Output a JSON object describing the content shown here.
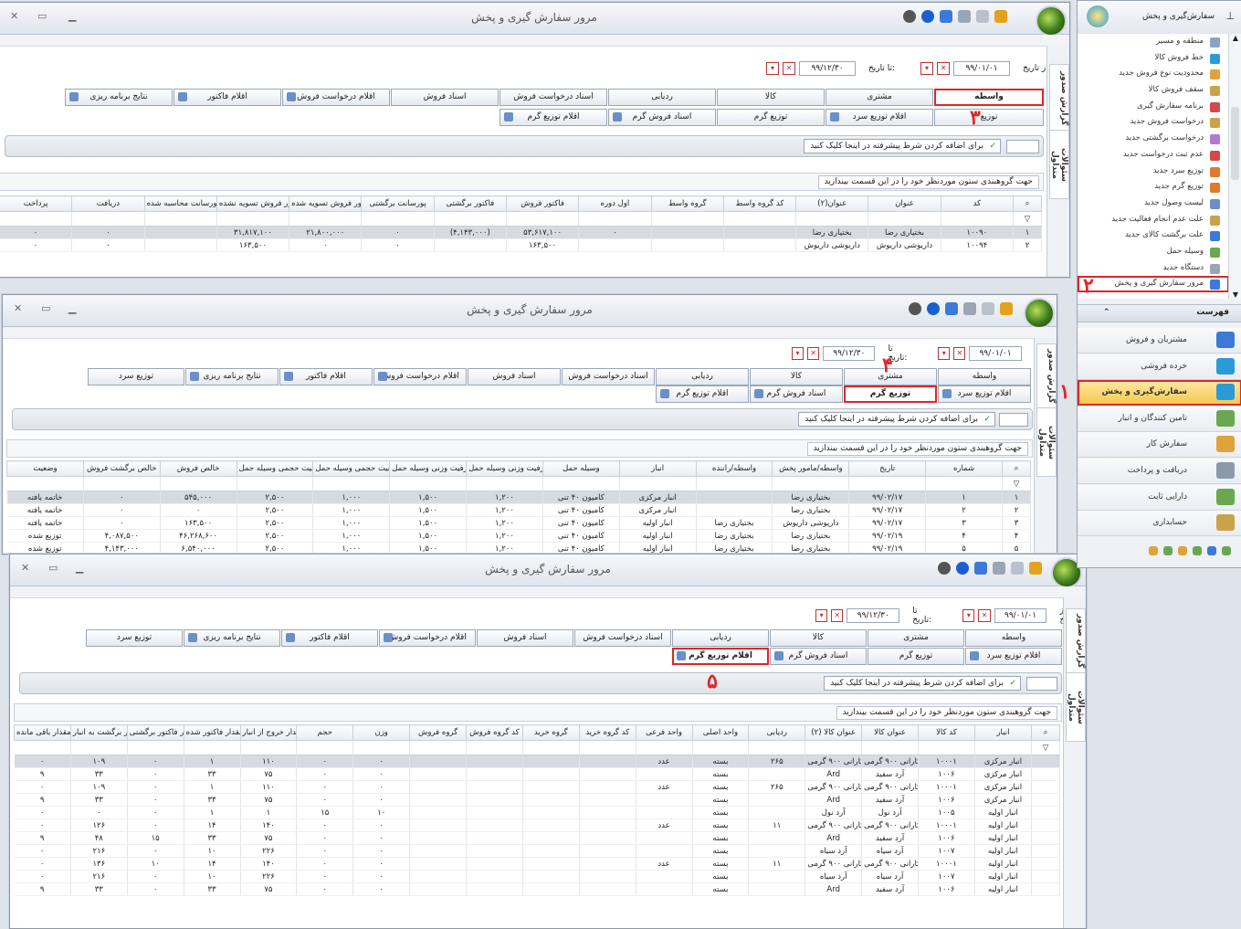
{
  "common": {
    "window_title": "مرور سفارش گیری و پخش",
    "from_label": "از تاریخ:",
    "to_label": "تا تاریخ:",
    "from_date": "۹۹/۰۱/۰۱",
    "to_date": "۹۹/۱۲/۳۰",
    "vtab_report": "گزارش صدور",
    "vtab_questions": "سئوالات متداول",
    "advanced_filter": "برای اضافه کردن شرط پیشرفته در اینجا کلیک کنید",
    "group_hint": "جهت گروهبندی ستون موردنظر خود را در این قسمت بیندازید"
  },
  "win1": {
    "tabs_row1": [
      "واسطه",
      "مشتری",
      "کالا",
      "ردیابی",
      "اسناد درخواست فروش",
      "اسناد فروش",
      "اقلام درخواست فروش",
      "اقلام فاکتور",
      "نتایج برنامه ریزی"
    ],
    "tabs_row2": [
      "توزیع",
      "اقلام توزیع سرد",
      "توزیع گرم",
      "اسناد فروش گرم",
      "اقلام توزیع گرم"
    ],
    "columns": [
      "کد",
      "عنوان",
      "عنوان(۲)",
      "کد گروه واسط",
      "گروه واسط",
      "اول دوره",
      "فاکتور فروش",
      "فاکتور برگشتی",
      "پورسانت برگشتی",
      "فاکتور فروش تسویه شده",
      "فاکتور فروش تسویه نشده",
      "مبلغ پورسانت محاسبه شده",
      "دریافت",
      "پرداخت"
    ],
    "rows": [
      [
        "۱۰۰۹۰",
        "بختیاری رضا",
        "بختیاری رضا",
        "",
        "",
        "۰",
        "۵۳,۶۱۷,۱۰۰",
        "(۴,۱۴۳,۰۰۰)",
        "۰",
        "۲۱,۸۰۰,۰۰۰",
        "۳۱,۸۱۷,۱۰۰",
        "",
        "۰",
        "۰"
      ],
      [
        "۱۰۰۹۴",
        "داریوشی داریوش",
        "داریوشی داریوش",
        "",
        "",
        "",
        "۱۶۳,۵۰۰",
        "",
        "۰",
        "۰",
        "۱۶۳,۵۰۰",
        "",
        "۰",
        "۰"
      ]
    ],
    "row_index": [
      "۱",
      "۲"
    ]
  },
  "win2": {
    "tabs_row1": [
      "واسطه",
      "مشتری",
      "کالا",
      "ردیابی",
      "اسناد درخواست فروش",
      "اسناد فروش",
      "اقلام درخواست فروش",
      "اقلام فاکتور",
      "نتایج برنامه ریزی",
      "توزیع سرد"
    ],
    "tabs_row2": [
      "اقلام توزیع سرد",
      "توزیع گرم",
      "اسناد فروش گرم",
      "اقلام توزیع گرم"
    ],
    "columns": [
      "شماره",
      "تاریخ",
      "واسطه/مامور پخش",
      "واسطه/راننده",
      "انبار",
      "وسیله حمل",
      "حداقل ظرفیت وزنی وسیله حمل",
      "حداکثر ظرفیت وزنی وسیله حمل",
      "حداقل ظرفیت حجمی وسیله حمل",
      "حداکثر ظرفیت حجمی وسیله حمل",
      "خالص فروش",
      "خالص برگشت فروش",
      "وضعیت"
    ],
    "rows": [
      [
        "۱",
        "۹۹/۰۲/۱۷",
        "بختیاری رضا",
        "",
        "انبار مرکزی",
        "کامیون ۴۰ تنی",
        "۱,۲۰۰",
        "۱,۵۰۰",
        "۱,۰۰۰",
        "۲,۵۰۰",
        "۵۴۵,۰۰۰",
        "۰",
        "خاتمه یافته"
      ],
      [
        "۲",
        "۹۹/۰۲/۱۷",
        "بختیاری رضا",
        "",
        "انبار مرکزی",
        "کامیون ۴۰ تنی",
        "۱,۲۰۰",
        "۱,۵۰۰",
        "۱,۰۰۰",
        "۲,۵۰۰",
        "۰",
        "۰",
        "خاتمه یافته"
      ],
      [
        "۳",
        "۹۹/۰۲/۱۷",
        "داریوشی داریوش",
        "بختیاری رضا",
        "انبار اولیه",
        "کامیون ۴۰ تنی",
        "۱,۲۰۰",
        "۱,۵۰۰",
        "۱,۰۰۰",
        "۲,۵۰۰",
        "۱۶۳,۵۰۰",
        "۰",
        "خاتمه یافته"
      ],
      [
        "۴",
        "۹۹/۰۲/۱۹",
        "بختیاری رضا",
        "بختیاری رضا",
        "انبار اولیه",
        "کامیون ۴۰ تنی",
        "۱,۲۰۰",
        "۱,۵۰۰",
        "۱,۰۰۰",
        "۲,۵۰۰",
        "۴۶,۲۶۸,۶۰۰",
        "۴,۰۸۷,۵۰۰",
        "توزیع شده"
      ],
      [
        "۵",
        "۹۹/۰۲/۱۹",
        "بختیاری رضا",
        "بختیاری رضا",
        "انبار اولیه",
        "کامیون ۴۰ تنی",
        "۱,۲۰۰",
        "۱,۵۰۰",
        "۱,۰۰۰",
        "۲,۵۰۰",
        "۶,۵۴۰,۰۰۰",
        "۴,۱۴۳,۰۰۰",
        "توزیع شده"
      ]
    ],
    "row_index": [
      "۱",
      "۲",
      "۳",
      "۴",
      "۵"
    ]
  },
  "win3": {
    "tabs_row1": [
      "واسطه",
      "مشتری",
      "کالا",
      "ردیابی",
      "اسناد درخواست فروش",
      "اسناد فروش",
      "اقلام درخواست فروش",
      "اقلام فاکتور",
      "نتایج برنامه ریزی",
      "توزیع سرد"
    ],
    "tabs_row2": [
      "اقلام توزیع سرد",
      "توزیع گرم",
      "اسناد فروش گرم",
      "اقلام توزیع گرم"
    ],
    "columns": [
      "انبار",
      "کد کالا",
      "عنوان کالا",
      "عنوان کالا (۲)",
      "ردیابی",
      "واحد اصلی",
      "واحد فرعی",
      "کد گروه خرید",
      "گروه خرید",
      "کد گروه فروش",
      "گروه فروش",
      "وزن",
      "حجم",
      "مقدار خروج از انبار",
      "مقدار فاکتور شده",
      "مقدار فاکتور برگشتی",
      "مقدار برگشت به انبار",
      "مقدار باقی مانده"
    ],
    "rows": [
      [
        "انبار مرکزی",
        "۱۰۰۰۱",
        "ماکارانی ۹۰۰ گرمی",
        "ماکارانی ۹۰۰ گرمی",
        "۲۶۵",
        "بسته",
        "عدد",
        "",
        "",
        "",
        "",
        "۰",
        "۰",
        "۱۱۰",
        "۱",
        "۰",
        "۱۰۹",
        "۰"
      ],
      [
        "انبار مرکزی",
        "۱۰۰۶",
        "آرد سفید",
        "Ard",
        "",
        "بسته",
        "",
        "",
        "",
        "",
        "",
        "۰",
        "۰",
        "۷۵",
        "۳۳",
        "۰",
        "۳۳",
        "۹"
      ],
      [
        "انبار مرکزی",
        "۱۰۰۰۱",
        "ماکارانی ۹۰۰ گرمی",
        "ماکارانی ۹۰۰ گرمی",
        "۲۶۵",
        "بسته",
        "عدد",
        "",
        "",
        "",
        "",
        "۰",
        "۰",
        "۱۱۰",
        "۱",
        "۰",
        "۱۰۹",
        "۰"
      ],
      [
        "انبار مرکزی",
        "۱۰۰۶",
        "آرد سفید",
        "Ard",
        "",
        "بسته",
        "",
        "",
        "",
        "",
        "",
        "۰",
        "۰",
        "۷۵",
        "۳۳",
        "۰",
        "۳۳",
        "۹"
      ],
      [
        "انبار اولیه",
        "۱۰۰۵",
        "آرد نول",
        "آرد نول",
        "",
        "بسته",
        "",
        "",
        "",
        "",
        "",
        "۱۰",
        "۱۵",
        "۱",
        "۱",
        "۰",
        "۰",
        "۰"
      ],
      [
        "انبار اولیه",
        "۱۰۰۰۱",
        "ماکارانی ۹۰۰ گرمی",
        "ماکارانی ۹۰۰ گرمی",
        "۱۱",
        "بسته",
        "عدد",
        "",
        "",
        "",
        "",
        "۰",
        "۰",
        "۱۴۰",
        "۱۴",
        "۰",
        "۱۲۶",
        "۰"
      ],
      [
        "انبار اولیه",
        "۱۰۰۶",
        "آرد سفید",
        "Ard",
        "",
        "بسته",
        "",
        "",
        "",
        "",
        "",
        "۰",
        "۰",
        "۷۵",
        "۳۳",
        "۱۵",
        "۴۸",
        "۹"
      ],
      [
        "انبار اولیه",
        "۱۰۰۷",
        "آرد سیاه",
        "آرد سیاه",
        "",
        "بسته",
        "",
        "",
        "",
        "",
        "",
        "۰",
        "۰",
        "۲۲۶",
        "۱۰",
        "۰",
        "۲۱۶",
        "۰"
      ],
      [
        "انبار اولیه",
        "۱۰۰۰۱",
        "ماکارانی ۹۰۰ گرمی",
        "ماکارانی ۹۰۰ گرمی",
        "۱۱",
        "بسته",
        "عدد",
        "",
        "",
        "",
        "",
        "۰",
        "۰",
        "۱۴۰",
        "۱۴",
        "۱۰",
        "۱۳۶",
        "۰"
      ],
      [
        "انبار اولیه",
        "۱۰۰۷",
        "آرد سیاه",
        "آرد سیاه",
        "",
        "بسته",
        "",
        "",
        "",
        "",
        "",
        "۰",
        "۰",
        "۲۲۶",
        "۱۰",
        "۰",
        "۲۱۶",
        "۰"
      ],
      [
        "انبار اولیه",
        "۱۰۰۶",
        "آرد سفید",
        "Ard",
        "",
        "بسته",
        "",
        "",
        "",
        "",
        "",
        "۰",
        "۰",
        "۷۵",
        "۳۳",
        "۰",
        "۳۳",
        "۹"
      ]
    ]
  },
  "annotations": {
    "n1": "۱",
    "n2": "۲",
    "n3": "۳",
    "n4": "۴",
    "n5": "۵"
  },
  "rpanel": {
    "title": "سفارش‌گیری و پخش",
    "items": [
      "منطقه و مسیر",
      "خط فروش کالا",
      "محدودیت نوع فروش جدید",
      "سقف فروش کالا",
      "برنامه سفارش گیری",
      "درخواست فروش جدید",
      "درخواست برگشتی جدید",
      "عدم ثبت درخواست جدید",
      "توزیع سرد جدید",
      "توزیع گرم جدید",
      "لیست وصول جدید",
      "علت عدم انجام فعالیت جدید",
      "علت برگشت کالای جدید",
      "وسیله حمل",
      "دستگاه جدید",
      "مرور سفارش گیری و پخش"
    ],
    "footer": "فهرست",
    "categories": [
      "مشتریان و فروش",
      "خرده فروشی",
      "سفارش‌گیری و پخش",
      "تامین کنندگان و انبار",
      "سفارش کار",
      "دریافت و پرداخت",
      "دارایی ثابت",
      "حسابداری"
    ]
  },
  "colors": {
    "accent_red": "#e0252a",
    "selected_cat": "#f5c84a"
  }
}
